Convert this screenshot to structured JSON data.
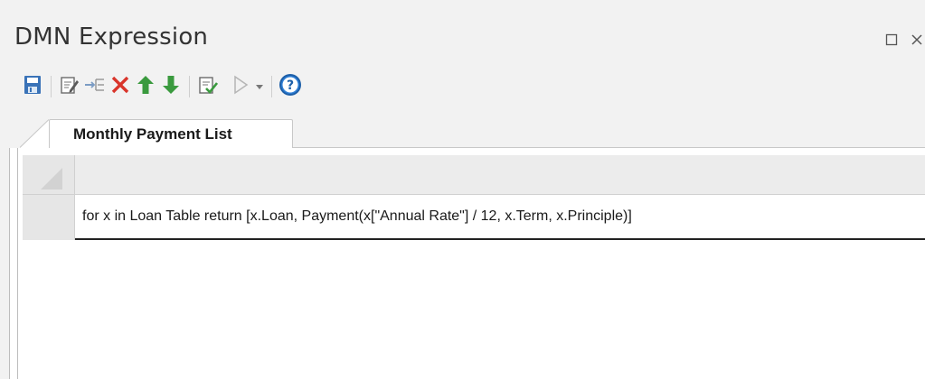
{
  "window": {
    "title": "DMN Expression",
    "controls": {
      "maximize_icon": "maximize-icon",
      "close_icon": "close-icon"
    }
  },
  "toolbar": {
    "buttons": [
      {
        "icon": "save-icon"
      },
      {
        "icon": "edit-properties-icon"
      },
      {
        "icon": "insert-item-icon"
      },
      {
        "icon": "delete-icon"
      },
      {
        "icon": "move-up-icon"
      },
      {
        "icon": "move-down-icon"
      },
      {
        "icon": "validate-icon"
      },
      {
        "icon": "run-simulation-icon"
      },
      {
        "icon": "dropdown-arrow-icon"
      },
      {
        "icon": "help-icon"
      }
    ]
  },
  "tabs": [
    {
      "label": "Monthly Payment List",
      "active": true
    }
  ],
  "grid": {
    "header_label": "",
    "rows": [
      {
        "row_label": "",
        "expression": "for x in Loan Table return [x.Loan, Payment(x[\"Annual Rate\"] / 12, x.Term, x.Principle)]"
      }
    ]
  },
  "colors": {
    "background": "#f2f2f2",
    "delete_red": "#d9352b",
    "arrow_green": "#3a9a3e",
    "save_blue": "#3a73b8",
    "help_blue": "#1d5fa8"
  }
}
